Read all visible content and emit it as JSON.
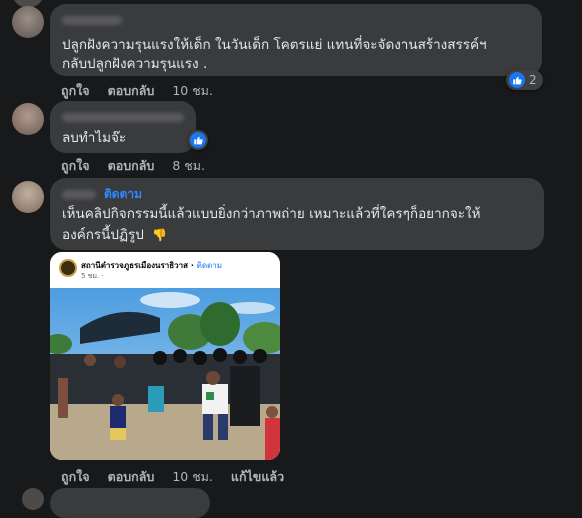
{
  "comments": [
    {
      "lines": [
        "ปลูกฝังความรุนแรงให้เด็ก ในวันเด็ก โคตรแย่ แทนที่จะจัดงานสร้างสรรค์ฯ",
        "กลับปลูกฝังความรุนแรง ."
      ],
      "like": "ถูกใจ",
      "reply": "ตอบกลับ",
      "time": "10 ชม.",
      "reaction_count": "2",
      "reaction_icon": "like-icon"
    },
    {
      "lines": [
        "ลบทำไมจ๊ะ"
      ],
      "like": "ถูกใจ",
      "reply": "ตอบกลับ",
      "time": "8 ชม.",
      "reaction_icon": "like-icon"
    },
    {
      "follow": "ติดตาม",
      "lines": [
        "เห็นคลิปกิจกรรมนี้แล้วแบบยิ่งกว่าภาพถ่าย เหมาะแล้วที่ใครๆก็อยากจะให้",
        "องค์กรนี้ปฏิรูป"
      ],
      "emoji": "👎",
      "like": "ถูกใจ",
      "reply": "ตอบกลับ",
      "time": "10 ชม.",
      "edited": "แก้ไขแล้ว",
      "shared_post": {
        "page_name": "สถานีตำรวจภูธรเมืองนราธิวาส",
        "follow": "ติดตาม",
        "meta": "5 ชม. ·"
      }
    }
  ],
  "colors": {
    "background": "#18191a",
    "bubble": "#3a3b3c",
    "link_blue": "#2d88ff",
    "like_blue": "#1877f2"
  }
}
